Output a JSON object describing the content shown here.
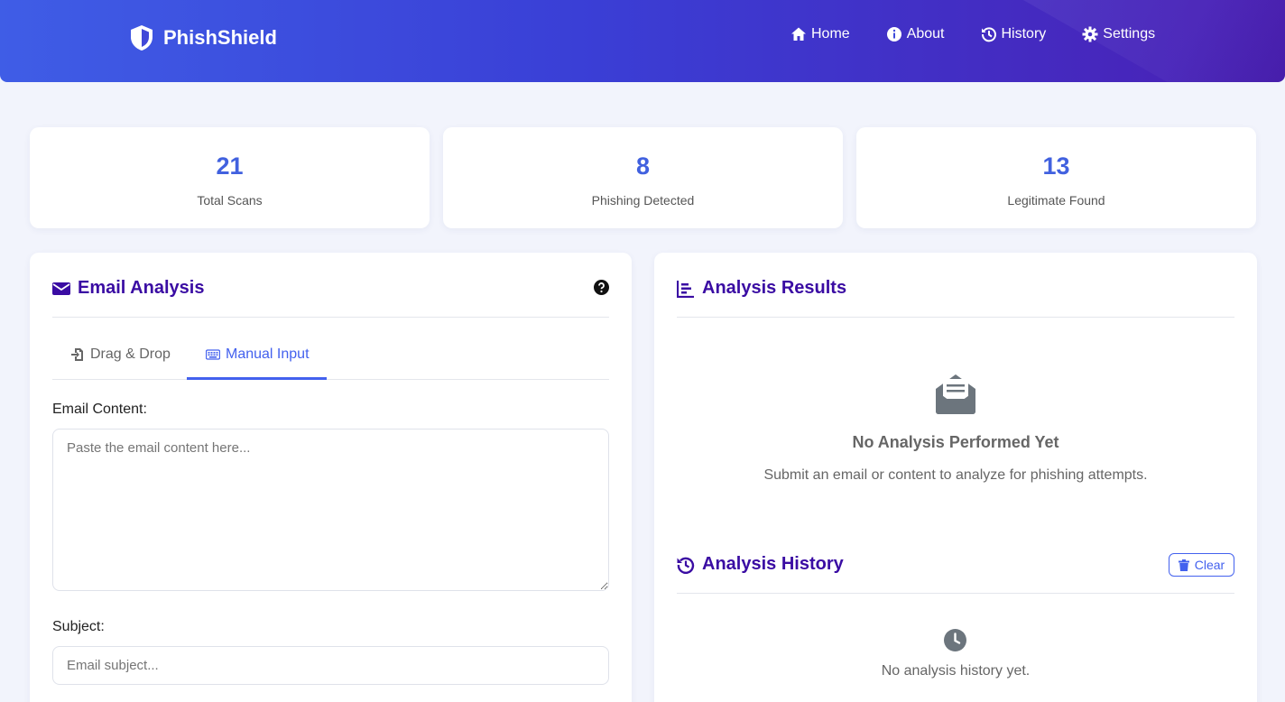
{
  "header": {
    "brand": "PhishShield",
    "nav": [
      {
        "label": "Home",
        "icon": "home-icon"
      },
      {
        "label": "About",
        "icon": "info-icon"
      },
      {
        "label": "History",
        "icon": "history-icon"
      },
      {
        "label": "Settings",
        "icon": "gear-icon"
      }
    ]
  },
  "stats": [
    {
      "value": "21",
      "label": "Total Scans"
    },
    {
      "value": "8",
      "label": "Phishing Detected"
    },
    {
      "value": "13",
      "label": "Legitimate Found"
    }
  ],
  "email_analysis": {
    "title": "Email Analysis",
    "tabs": [
      {
        "label": "Drag & Drop",
        "icon": "file-import-icon"
      },
      {
        "label": "Manual Input",
        "icon": "keyboard-icon",
        "active": true
      }
    ],
    "content_label": "Email Content:",
    "content_placeholder": "Paste the email content here...",
    "subject_label": "Subject:",
    "subject_placeholder": "Email subject..."
  },
  "results": {
    "title": "Analysis Results",
    "empty_title": "No Analysis Performed Yet",
    "empty_subtitle": "Submit an email or content to analyze for phishing attempts."
  },
  "history": {
    "title": "Analysis History",
    "clear_label": "Clear",
    "empty_text": "No analysis history yet."
  },
  "colors": {
    "accent": "#4361ee",
    "title": "#3a0ca3",
    "stat_number": "#4161df"
  }
}
